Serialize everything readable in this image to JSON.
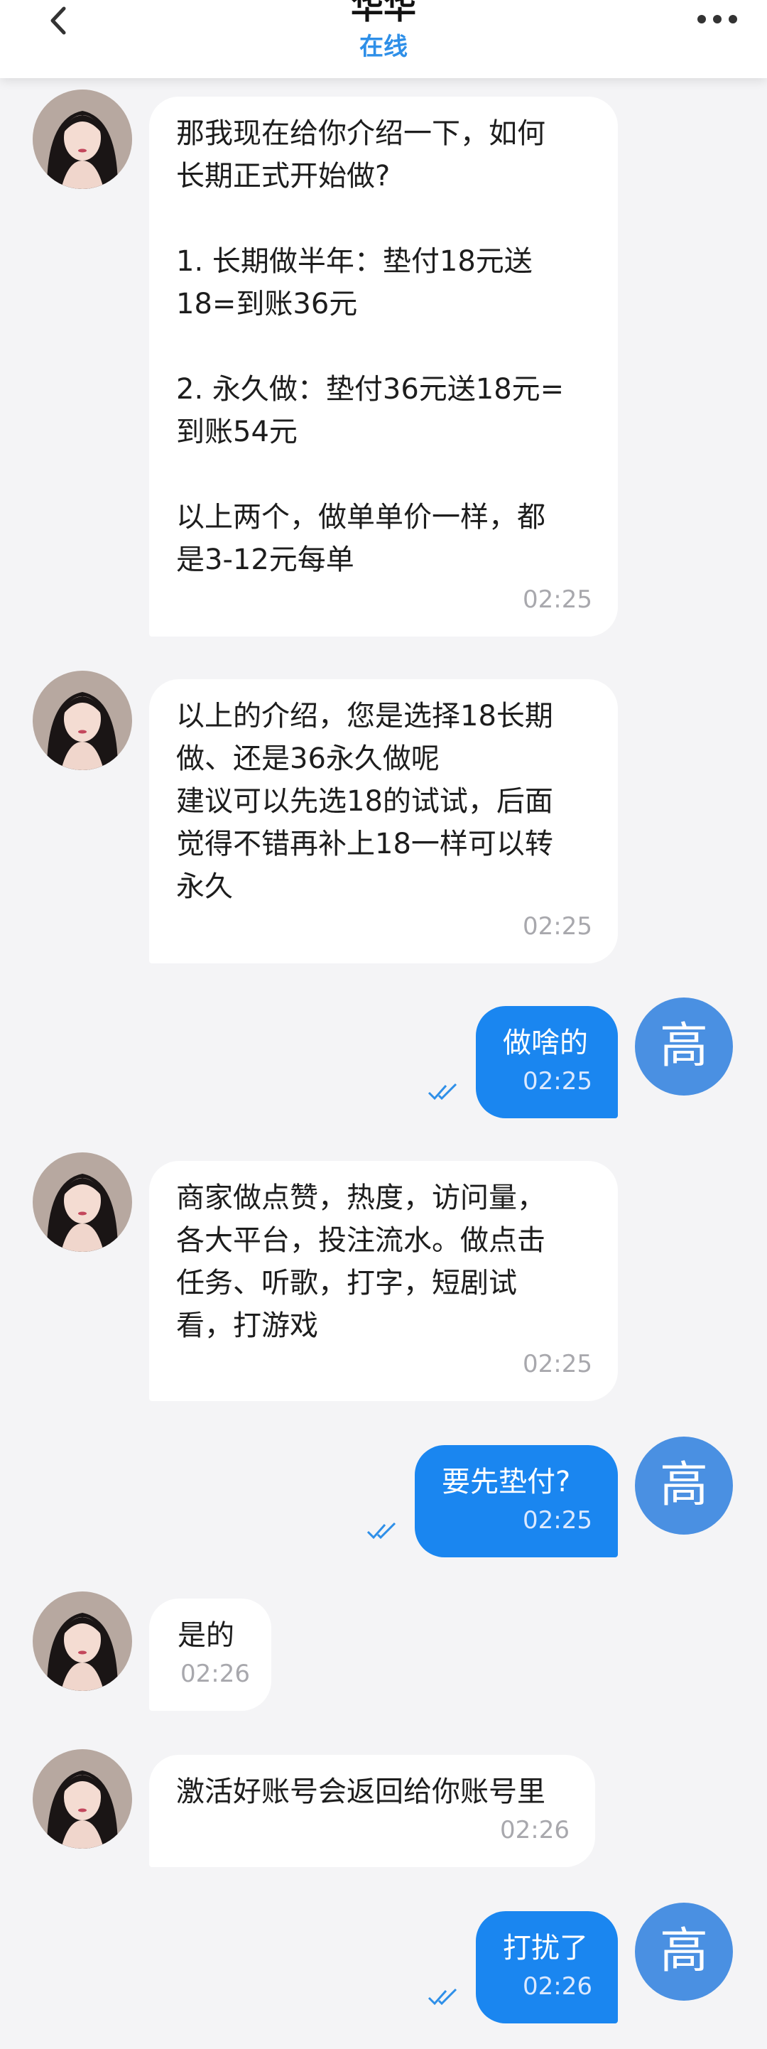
{
  "header": {
    "title": "华华",
    "status": "在线"
  },
  "me": {
    "avatar_text": "高"
  },
  "messages": [
    {
      "text": "那我现在给你介绍一下，如何\n长期正式开始做?\n\n1. 长期做半年：垫付18元送\n18=到账36元\n\n2. 永久做：垫付36元送18元=\n到账54元\n\n以上两个，做单单价一样，都\n是3-12元每单",
      "time": "02:25"
    },
    {
      "text": "以上的介绍，您是选择18长期\n做、还是36永久做呢\n建议可以先选18的试试，后面\n觉得不错再补上18一样可以转\n永久",
      "time": "02:25"
    },
    {
      "text": "做啥的",
      "time": "02:25"
    },
    {
      "text": "商家做点赞，热度，访问量，\n各大平台，投注流水。做点击\n任务、听歌，打字，短剧试\n看，打游戏",
      "time": "02:25"
    },
    {
      "text": "要先垫付?",
      "time": "02:25"
    },
    {
      "text": "是的",
      "time": "02:26"
    },
    {
      "text": "激活好账号会返回给你账号里",
      "time": "02:26"
    },
    {
      "text": "打扰了",
      "time": "02:26"
    }
  ]
}
